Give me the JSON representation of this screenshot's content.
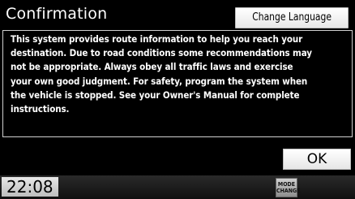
{
  "dialog": {
    "title": "Confirmation",
    "change_language_label": "Change Language",
    "message_lines": [
      "This system provides route information to help you reach your",
      "destination. Due to road conditions some recommendations may",
      "not be appropriate. Always obey all traffic laws and exercise",
      "your own good judgment. For safety, program the system when",
      "the vehicle is stopped. See your Owner's Manual for complete",
      "instructions."
    ],
    "ok_label": "OK"
  },
  "status_bar": {
    "clock": "22:08",
    "mode_change_line1": "MODE",
    "mode_change_line2": "CHANGE"
  },
  "colors": {
    "background": "#000000",
    "text": "#ffffff",
    "button": "#f2f2f2"
  }
}
